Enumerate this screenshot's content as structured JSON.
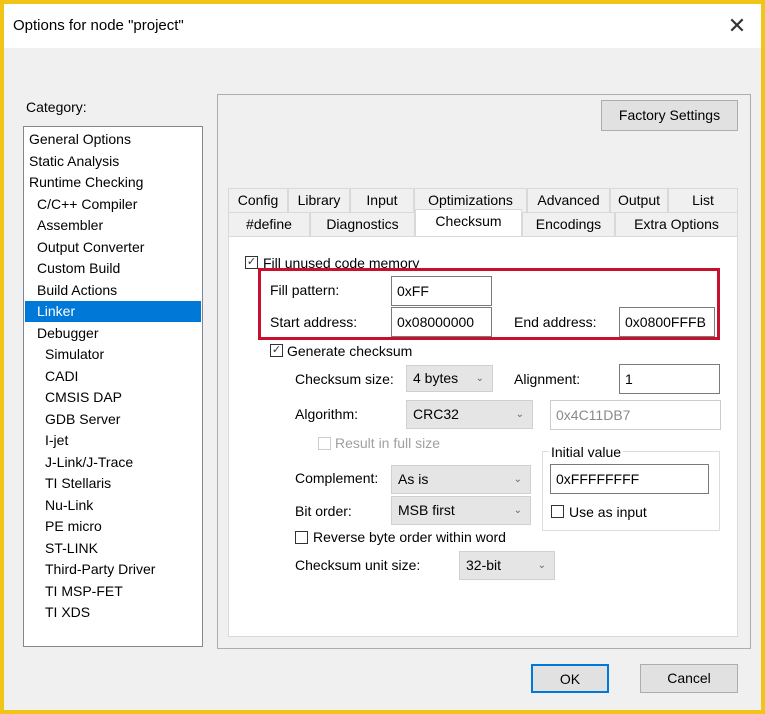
{
  "window": {
    "title": "Options for node \"project\"",
    "close_icon": "close-icon"
  },
  "category": {
    "label": "Category:",
    "items": [
      {
        "label": "General Options",
        "level": 0
      },
      {
        "label": "Static Analysis",
        "level": 0
      },
      {
        "label": "Runtime Checking",
        "level": 0
      },
      {
        "label": "C/C++ Compiler",
        "level": 1
      },
      {
        "label": "Assembler",
        "level": 1
      },
      {
        "label": "Output Converter",
        "level": 1
      },
      {
        "label": "Custom Build",
        "level": 1
      },
      {
        "label": "Build Actions",
        "level": 1
      },
      {
        "label": "Linker",
        "level": 1,
        "selected": true
      },
      {
        "label": "Debugger",
        "level": 1
      },
      {
        "label": "Simulator",
        "level": 2
      },
      {
        "label": "CADI",
        "level": 2
      },
      {
        "label": "CMSIS DAP",
        "level": 2
      },
      {
        "label": "GDB Server",
        "level": 2
      },
      {
        "label": "I-jet",
        "level": 2
      },
      {
        "label": "J-Link/J-Trace",
        "level": 2
      },
      {
        "label": "TI Stellaris",
        "level": 2
      },
      {
        "label": "Nu-Link",
        "level": 2
      },
      {
        "label": "PE micro",
        "level": 2
      },
      {
        "label": "ST-LINK",
        "level": 2
      },
      {
        "label": "Third-Party Driver",
        "level": 2
      },
      {
        "label": "TI MSP-FET",
        "level": 2
      },
      {
        "label": "TI XDS",
        "level": 2
      }
    ]
  },
  "factory_settings": "Factory Settings",
  "tabs": {
    "row1": [
      "Config",
      "Library",
      "Input",
      "Optimizations",
      "Advanced",
      "Output",
      "List"
    ],
    "row2": [
      "#define",
      "Diagnostics",
      "Checksum",
      "Encodings",
      "Extra Options"
    ],
    "active": "Checksum"
  },
  "checksum": {
    "fill_unused": {
      "label": "Fill unused code memory",
      "checked": true
    },
    "fill_pattern": {
      "label": "Fill pattern:",
      "value": "0xFF"
    },
    "start_address": {
      "label": "Start address:",
      "value": "0x08000000"
    },
    "end_address": {
      "label": "End address:",
      "value": "0x0800FFFB"
    },
    "generate": {
      "label": "Generate checksum",
      "checked": true
    },
    "size": {
      "label": "Checksum size:",
      "value": "4 bytes"
    },
    "alignment": {
      "label": "Alignment:",
      "value": "1"
    },
    "algorithm": {
      "label": "Algorithm:",
      "value": "CRC32",
      "poly": "0x4C11DB7"
    },
    "full_size": {
      "label": "Result in full size",
      "checked": false,
      "disabled": true
    },
    "initial": {
      "label": "Initial value",
      "value": "0xFFFFFFFF",
      "use_as_input": "Use as input"
    },
    "complement": {
      "label": "Complement:",
      "value": "As is"
    },
    "bit_order": {
      "label": "Bit order:",
      "value": "MSB first"
    },
    "reverse": {
      "label": "Reverse byte order within word",
      "checked": false
    },
    "unit_size": {
      "label": "Checksum unit size:",
      "value": "32-bit"
    }
  },
  "highlight_color": "#c8102e",
  "buttons": {
    "ok": "OK",
    "cancel": "Cancel"
  }
}
